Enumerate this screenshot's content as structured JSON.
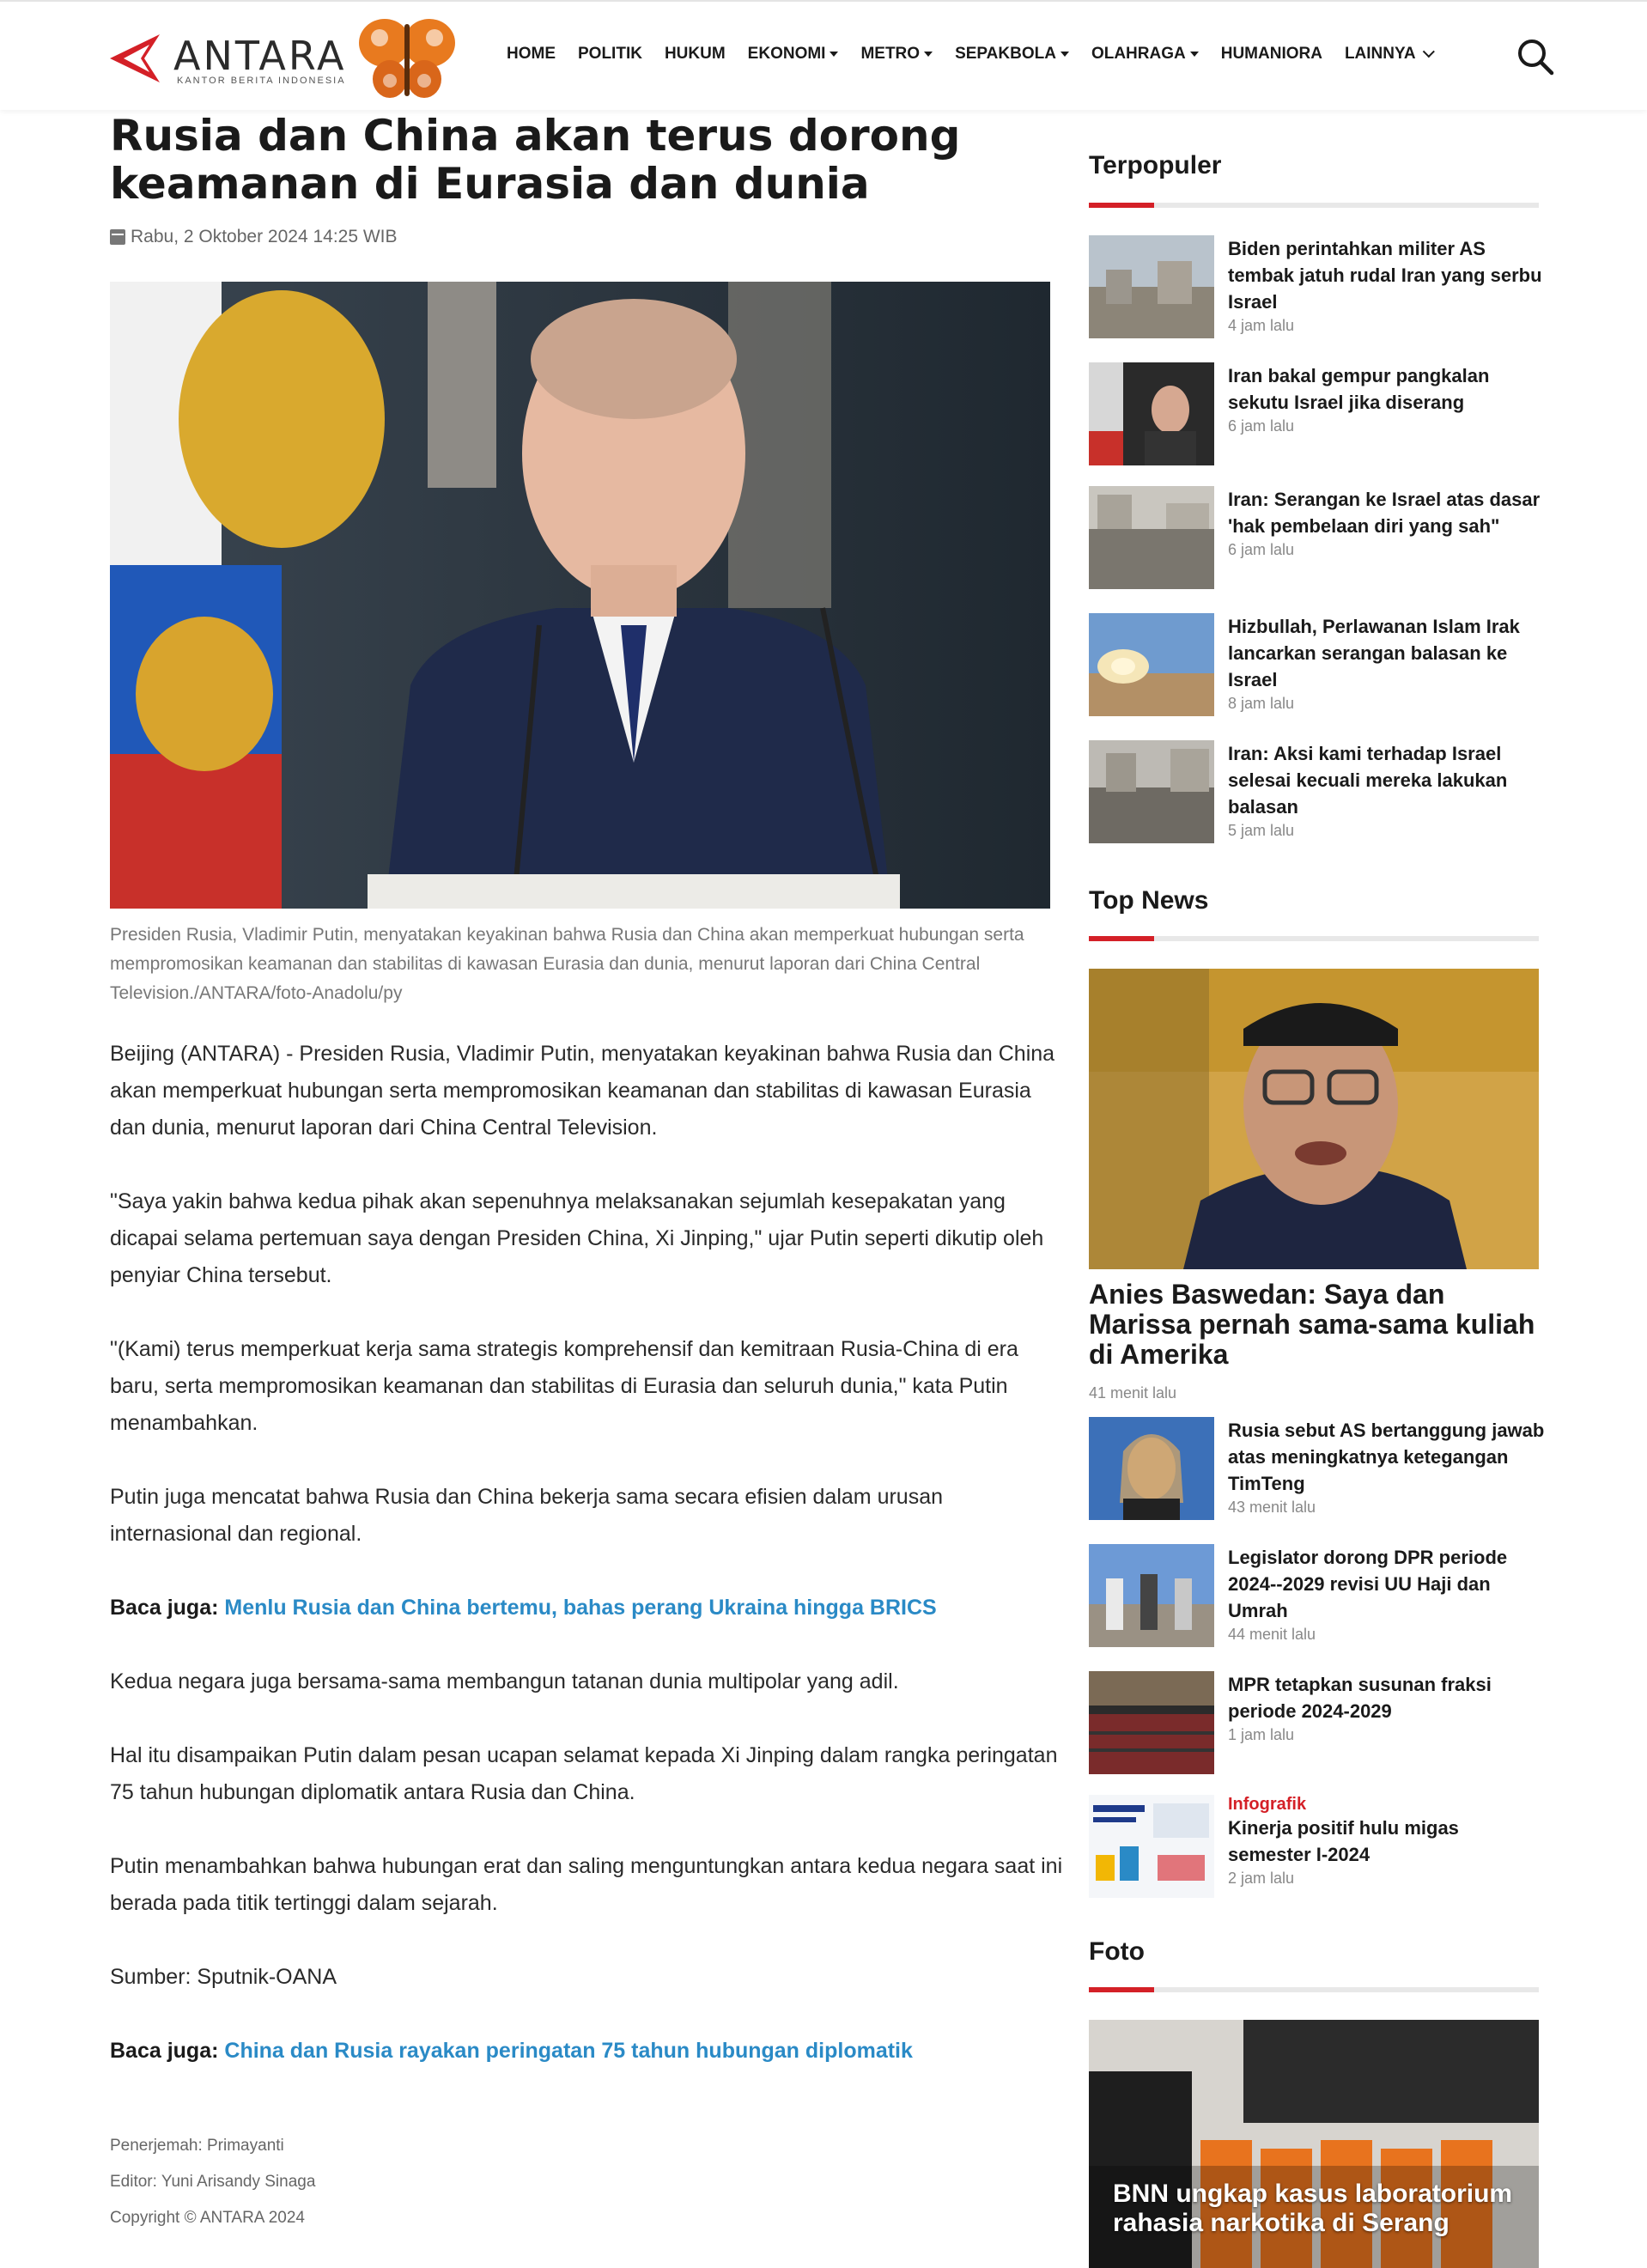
{
  "brand": {
    "name": "ANTARA",
    "tagline": "KANTOR BERITA INDONESIA",
    "red": "#d42027"
  },
  "nav": [
    {
      "label": "HOME",
      "caret": false
    },
    {
      "label": "POLITIK",
      "caret": false
    },
    {
      "label": "HUKUM",
      "caret": false
    },
    {
      "label": "EKONOMI",
      "caret": true
    },
    {
      "label": "METRO",
      "caret": true
    },
    {
      "label": "SEPAKBOLA",
      "caret": true
    },
    {
      "label": "OLAHRAGA",
      "caret": true
    },
    {
      "label": "HUMANIORA",
      "caret": false
    },
    {
      "label": "LAINNYA",
      "caret": false
    }
  ],
  "article": {
    "title": "Rusia dan China akan terus dorong keamanan di Eurasia dan dunia",
    "date": "Rabu, 2 Oktober 2024 14:25 WIB",
    "caption": "Presiden Rusia, Vladimir Putin, menyatakan keyakinan bahwa Rusia dan China akan memperkuat hubungan serta mempromosikan keamanan dan stabilitas di kawasan Eurasia dan dunia, menurut laporan dari China Central Television./ANTARA/foto-Anadolu/py",
    "paragraphs": {
      "p1": "Beijing (ANTARA) - Presiden Rusia, Vladimir Putin, menyatakan keyakinan bahwa Rusia dan China akan memperkuat hubungan serta mempromosikan keamanan dan stabilitas di kawasan Eurasia dan dunia, menurut laporan dari China Central Television.",
      "p2": "\"Saya yakin bahwa kedua pihak akan sepenuhnya melaksanakan sejumlah kesepakatan yang dicapai selama pertemuan saya dengan Presiden China, Xi Jinping,\" ujar Putin seperti dikutip oleh penyiar China tersebut.",
      "p3": "\"(Kami) terus memperkuat kerja sama strategis komprehensif dan kemitraan Rusia-China di era baru, serta mempromosikan keamanan dan stabilitas di Eurasia dan seluruh dunia,\" kata Putin menambahkan.",
      "p4": "Putin juga mencatat bahwa Rusia dan China bekerja sama secara efisien dalam urusan internasional dan regional.",
      "p5": "Kedua negara juga bersama-sama membangun tatanan dunia multipolar yang adil.",
      "p6": "Hal itu disampaikan Putin dalam pesan ucapan selamat kepada Xi Jinping dalam rangka peringatan 75 tahun hubungan diplomatik antara Rusia dan China.",
      "p7": "Putin menambahkan bahwa hubungan erat dan saling menguntungkan antara kedua negara saat ini berada pada titik tertinggi dalam sejarah.",
      "p8": "Sumber: Sputnik-OANA"
    },
    "related_label": "Baca juga:",
    "related1": "Menlu Rusia dan China bertemu, bahas perang Ukraina hingga BRICS",
    "related2": "China dan Rusia rayakan peringatan 75 tahun hubungan diplomatik",
    "translator": "Penerjemah: Primayanti",
    "editor": "Editor: Yuni Arisandy Sinaga",
    "copyright": "Copyright © ANTARA 2024"
  },
  "sidebar": {
    "populer_title": "Terpopuler",
    "populer": [
      {
        "headline": "Biden perintahkan militer AS tembak jatuh rudal Iran yang serbu Israel",
        "time": "4 jam lalu"
      },
      {
        "headline": "Iran bakal gempur pangkalan sekutu Israel jika diserang",
        "time": "6 jam lalu"
      },
      {
        "headline": "Iran: Serangan ke Israel atas dasar 'hak pembelaan diri yang sah\"",
        "time": "6 jam lalu"
      },
      {
        "headline": "Hizbullah, Perlawanan Islam Irak lancarkan serangan balasan ke Israel",
        "time": "8 jam lalu"
      },
      {
        "headline": "Iran: Aksi kami terhadap Israel selesai kecuali mereka lakukan balasan",
        "time": "5 jam lalu"
      }
    ],
    "topnews_title": "Top News",
    "topnews_main": {
      "headline": "Anies Baswedan: Saya dan Marissa pernah sama-sama kuliah di Amerika",
      "time": "41 menit lalu"
    },
    "topnews": [
      {
        "headline": "Rusia sebut AS bertanggung jawab atas meningkatnya ketegangan TimTeng",
        "time": "43 menit lalu"
      },
      {
        "headline": "Legislator dorong DPR periode 2024--2029 revisi UU Haji dan Umrah",
        "time": "44 menit lalu"
      },
      {
        "headline": "MPR tetapkan susunan fraksi periode 2024-2029",
        "time": "1 jam lalu"
      },
      {
        "category": "Infografik",
        "headline": "Kinerja positif hulu migas semester I-2024",
        "time": "2 jam lalu"
      }
    ],
    "foto_title": "Foto",
    "foto_caption": "BNN ungkap kasus laboratorium rahasia narkotika di Serang"
  }
}
